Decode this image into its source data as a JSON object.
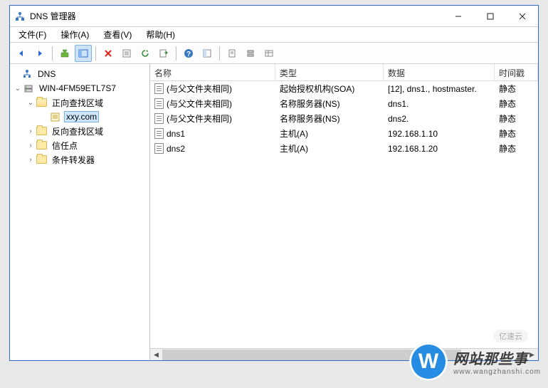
{
  "window": {
    "title": "DNS 管理器"
  },
  "menubar": [
    {
      "label": "文件(F)"
    },
    {
      "label": "操作(A)"
    },
    {
      "label": "查看(V)"
    },
    {
      "label": "帮助(H)"
    }
  ],
  "tree": {
    "root": "DNS",
    "server": "WIN-4FM59ETL7S7",
    "nodes": [
      {
        "label": "正向查找区域",
        "children": [
          {
            "label": "xxy.com",
            "selected": true
          }
        ]
      },
      {
        "label": "反向查找区域"
      },
      {
        "label": "信任点"
      },
      {
        "label": "条件转发器"
      }
    ]
  },
  "columns": {
    "name": "名称",
    "type": "类型",
    "data": "数据",
    "ts": "时间戳"
  },
  "records": [
    {
      "name": "(与父文件夹相同)",
      "type": "起始授权机构(SOA)",
      "data": "[12], dns1., hostmaster.",
      "ts": "静态"
    },
    {
      "name": "(与父文件夹相同)",
      "type": "名称服务器(NS)",
      "data": "dns1.",
      "ts": "静态"
    },
    {
      "name": "(与父文件夹相同)",
      "type": "名称服务器(NS)",
      "data": "dns2.",
      "ts": "静态"
    },
    {
      "name": "dns1",
      "type": "主机(A)",
      "data": "192.168.1.10",
      "ts": "静态"
    },
    {
      "name": "dns2",
      "type": "主机(A)",
      "data": "192.168.1.20",
      "ts": "静态"
    }
  ],
  "watermark": {
    "w": "W",
    "big": "网站那些事",
    "small": "www.wangzhanshi.com",
    "yiyun": "亿速云"
  }
}
